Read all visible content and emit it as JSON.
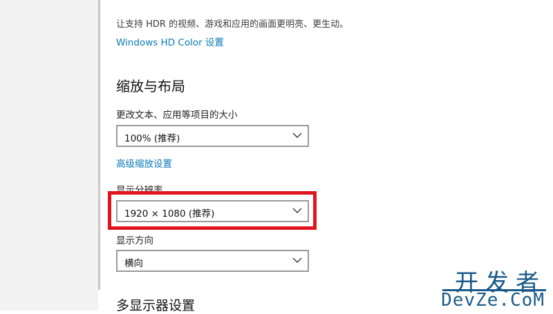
{
  "hdr": {
    "description": "让支持 HDR 的视频、游戏和应用的画面更明亮、更生动。",
    "link": "Windows HD Color 设置"
  },
  "scale_layout": {
    "title": "缩放与布局",
    "size_label": "更改文本、应用等项目的大小",
    "size_value": "100% (推荐)",
    "advanced_link": "高级缩放设置",
    "resolution_label": "显示分辨率",
    "resolution_value": "1920 × 1080 (推荐)",
    "orientation_label": "显示方向",
    "orientation_value": "横向"
  },
  "multi_display": {
    "title": "多显示器设置"
  },
  "watermark": {
    "chinese": "开发者",
    "english": "DevZe.CoM"
  },
  "colors": {
    "link": "#0a7ab8",
    "highlight": "#e0141e"
  },
  "icons": {
    "dropdown": "chevron-down-icon"
  }
}
